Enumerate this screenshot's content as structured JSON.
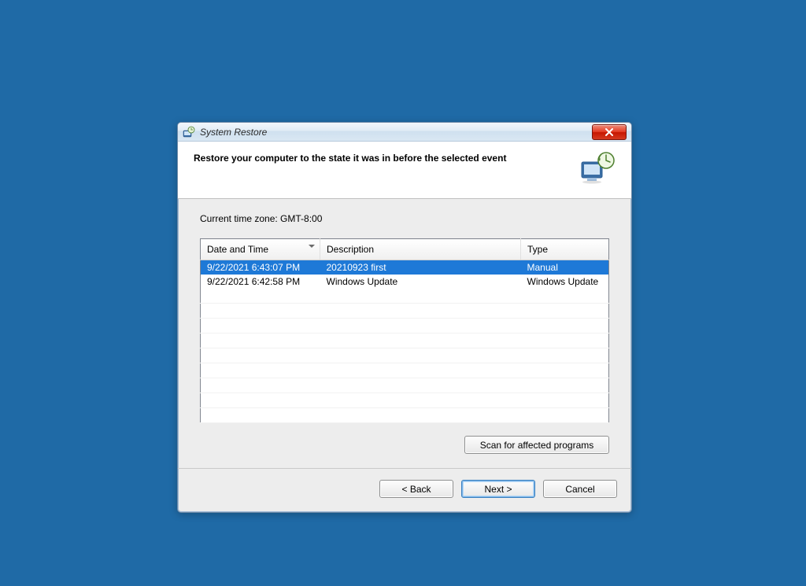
{
  "window": {
    "title": "System Restore"
  },
  "header": {
    "heading": "Restore your computer to the state it was in before the selected event"
  },
  "body": {
    "timezone_line": "Current time zone: GMT-8:00"
  },
  "table": {
    "columns": {
      "datetime": "Date and Time",
      "description": "Description",
      "type": "Type"
    },
    "rows": [
      {
        "datetime": "9/22/2021 6:43:07 PM",
        "description": "20210923 first",
        "type": "Manual",
        "selected": true
      },
      {
        "datetime": "9/22/2021 6:42:58 PM",
        "description": "Windows Update",
        "type": "Windows Update",
        "selected": false
      }
    ]
  },
  "buttons": {
    "scan": "Scan for affected programs",
    "back": "< Back",
    "next": "Next >",
    "cancel": "Cancel"
  }
}
